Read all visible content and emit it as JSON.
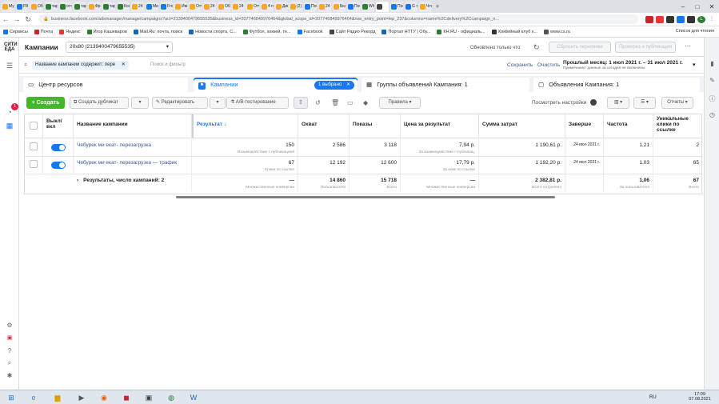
{
  "browser": {
    "tabs": [
      "Му",
      "FB Fac",
      "Об",
      "тар",
      "отч",
      "тар",
      "Фр",
      "тар",
      "Кон",
      "24",
      "Ми",
      "Fro",
      "Им",
      "Отч",
      "24",
      "Об",
      "24",
      "Отч",
      "4 п",
      "Дик",
      "(2)",
      "Пос",
      "24",
      "Бюд",
      "Пос",
      "Wh",
      "",
      "Пос",
      "G топ",
      "Что"
    ],
    "url": "business.facebook.com/adsmanager/manage/campaigns?act=2139400479655535&business_id=207746849976464&global_scope_id=207746849976464&nav_entry_point=lep_237&columns=name%2Cdelivery%2Ccampaign_n...",
    "bookmarks": [
      "Сервисы",
      "Почта",
      "Яндекс",
      "Игор Кашеваров",
      "Mail.Ru: почта, поиск",
      "Новости спорта, С...",
      "Футбол, хоккей, те...",
      "Facebook",
      "Сайт Радио Рекорд",
      "Портал НТТУ | Обу...",
      "КН.RU - официаль...",
      "Хоккейный клуб к...",
      "www.cs.ru"
    ],
    "bookmarks_right": "Список для чтения",
    "profile_initial": "L"
  },
  "header": {
    "section": "Кампании",
    "account": "20x80 (2139400479655535)",
    "status": "Обновлено только что",
    "discard_label": "Сбросить черновики",
    "review_label": "Проверка и публикация"
  },
  "filter": {
    "chip": "Название кампании содержит: пере",
    "placeholder": "Поиск и фильтр",
    "save_label": "Сохранить",
    "clear_label": "Очистить",
    "date_range": "Прошлый месяц: 1 июл 2021 г. – 31 июл 2021 г.",
    "date_note": "Примечание: данные за сегодня не включены"
  },
  "tabs": {
    "resources": "Центр ресурсов",
    "campaigns": "Кампании",
    "selected_badge": "1 выбрано",
    "adsets": "Группы объявлений Кампания: 1",
    "ads": "Объявления Кампания: 1"
  },
  "toolbar": {
    "create": "+ Создать",
    "duplicate": "Создать дубликат",
    "edit": "Редактировать",
    "ab_test": "A/B-тестирование",
    "rules": "Правила",
    "view_settings": "Посмотреть настройки",
    "reports": "Отчеты"
  },
  "table": {
    "headers": {
      "toggle": "Выкл/вкл",
      "name": "Название кампании",
      "result": "Результат ↓",
      "reach": "Охват",
      "impressions": "Показы",
      "cost_per_result": "Цена за результат",
      "spent": "Сумма затрат",
      "ends": "Заверше",
      "frequency": "Частота",
      "unique_clicks": "Уникальные клики по ссылке"
    },
    "rows": [
      {
        "name": "Чебурек ми екат- перезагрузка",
        "result": "150",
        "result_sub": "Взаимодействие с публикацией",
        "reach": "2 586",
        "impressions": "3 118",
        "cost": "7,94 р.",
        "cost_sub": "За взаимодействие с публикац.",
        "spent": "1 190,61 р.",
        "ends": "24 июл 2021 г.",
        "frequency": "1,21",
        "unique_clicks": "2"
      },
      {
        "name": "Чебурек ми екат- перезагрузка — трафик",
        "result": "67",
        "result_sub": "Клики по ссылке",
        "reach": "12 192",
        "impressions": "12 600",
        "cost": "17,79 р.",
        "cost_sub": "За клик по ссылке",
        "spent": "1 192,20 р.",
        "ends": "24 июл 2021 г.",
        "frequency": "1,03",
        "unique_clicks": "65"
      }
    ],
    "totals": {
      "label": "Результаты, число кампаний: 2",
      "result": "—",
      "result_sub": "Множественные конверсии",
      "reach": "14 860",
      "reach_sub": "Пользователи",
      "impressions": "15 718",
      "impressions_sub": "Всего",
      "cost": "—",
      "cost_sub": "Множественные конверсии",
      "spent": "2 382,81 р.",
      "spent_sub": "Всего потрачено",
      "frequency": "1,06",
      "frequency_sub": "За пользователя",
      "unique_clicks": "67",
      "unique_clicks_sub": "Всего"
    }
  },
  "leftnav": {
    "badge": "1"
  },
  "taskbar": {
    "lang": "RU",
    "time": "17:09",
    "date": "07.08.2021"
  }
}
